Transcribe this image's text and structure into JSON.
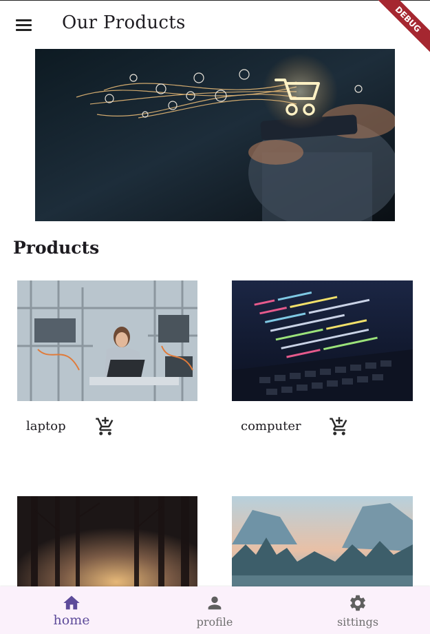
{
  "app_bar": {
    "title": "Our Products",
    "debug_banner": "DEBUG"
  },
  "section": {
    "title": "Products"
  },
  "products": [
    {
      "name": "laptop"
    },
    {
      "name": "computer"
    },
    {
      "name": ""
    },
    {
      "name": ""
    }
  ],
  "bottom_nav": {
    "items": [
      {
        "label": "home",
        "icon": "home-icon",
        "active": true
      },
      {
        "label": "profile",
        "icon": "person-icon",
        "active": false
      },
      {
        "label": "sittings",
        "icon": "gear-icon",
        "active": false
      }
    ]
  },
  "colors": {
    "accent": "#5d4b9a",
    "nav_background": "#fbf1fb",
    "debug": "#a52730"
  }
}
